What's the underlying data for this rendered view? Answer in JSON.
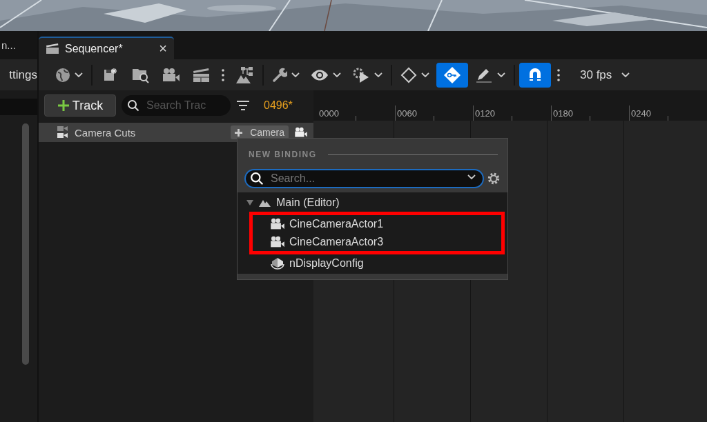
{
  "left_panel": {
    "tab_label": "n...",
    "header": "ttings"
  },
  "tab": {
    "title": "Sequencer*",
    "close": "×"
  },
  "toolbar": {
    "groups": [
      [
        {
          "kind": "globe",
          "menu": true,
          "on": false
        }
      ],
      [
        {
          "kind": "save",
          "menu": false,
          "on": false
        },
        {
          "kind": "folder-search",
          "menu": false,
          "on": false
        },
        {
          "kind": "camera",
          "menu": false,
          "on": false
        },
        {
          "kind": "clapper",
          "menu": false,
          "on": false
        },
        {
          "kind": "kebab",
          "menu": false,
          "on": false
        },
        {
          "kind": "hierarchy",
          "menu": false,
          "on": false
        }
      ],
      [
        {
          "kind": "wrench",
          "menu": true,
          "on": false
        },
        {
          "kind": "eye",
          "menu": true,
          "on": false
        },
        {
          "kind": "gear-play",
          "menu": true,
          "on": false
        }
      ],
      [
        {
          "kind": "diamond",
          "menu": true,
          "on": false
        },
        {
          "kind": "key",
          "menu": false,
          "on": true
        },
        {
          "kind": "pencil",
          "menu": true,
          "on": false
        }
      ],
      [
        {
          "kind": "magnet",
          "menu": false,
          "on": true
        },
        {
          "kind": "kebab",
          "menu": false,
          "on": false
        }
      ]
    ],
    "frame_rate": "30 fps"
  },
  "track_bar": {
    "add_label": "Track",
    "search_placeholder": "Search Trac",
    "current_frame": "0496*"
  },
  "ruler": {
    "ticks": [
      "0000",
      "0060",
      "0120",
      "0180",
      "0240"
    ]
  },
  "tracks": [
    {
      "name": "Camera Cuts",
      "button": "Camera"
    }
  ],
  "popup": {
    "section": "NEW BINDING",
    "search_placeholder": "Search...",
    "tree": [
      {
        "label": "Main (Editor)",
        "kind": "level",
        "expanded": true,
        "children": [
          {
            "label": "CineCameraActor1",
            "kind": "camera",
            "highlighted": true
          },
          {
            "label": "CineCameraActor3",
            "kind": "camera",
            "highlighted": true
          },
          {
            "label": "nDisplayConfig",
            "kind": "display",
            "highlighted": false
          }
        ]
      }
    ]
  }
}
